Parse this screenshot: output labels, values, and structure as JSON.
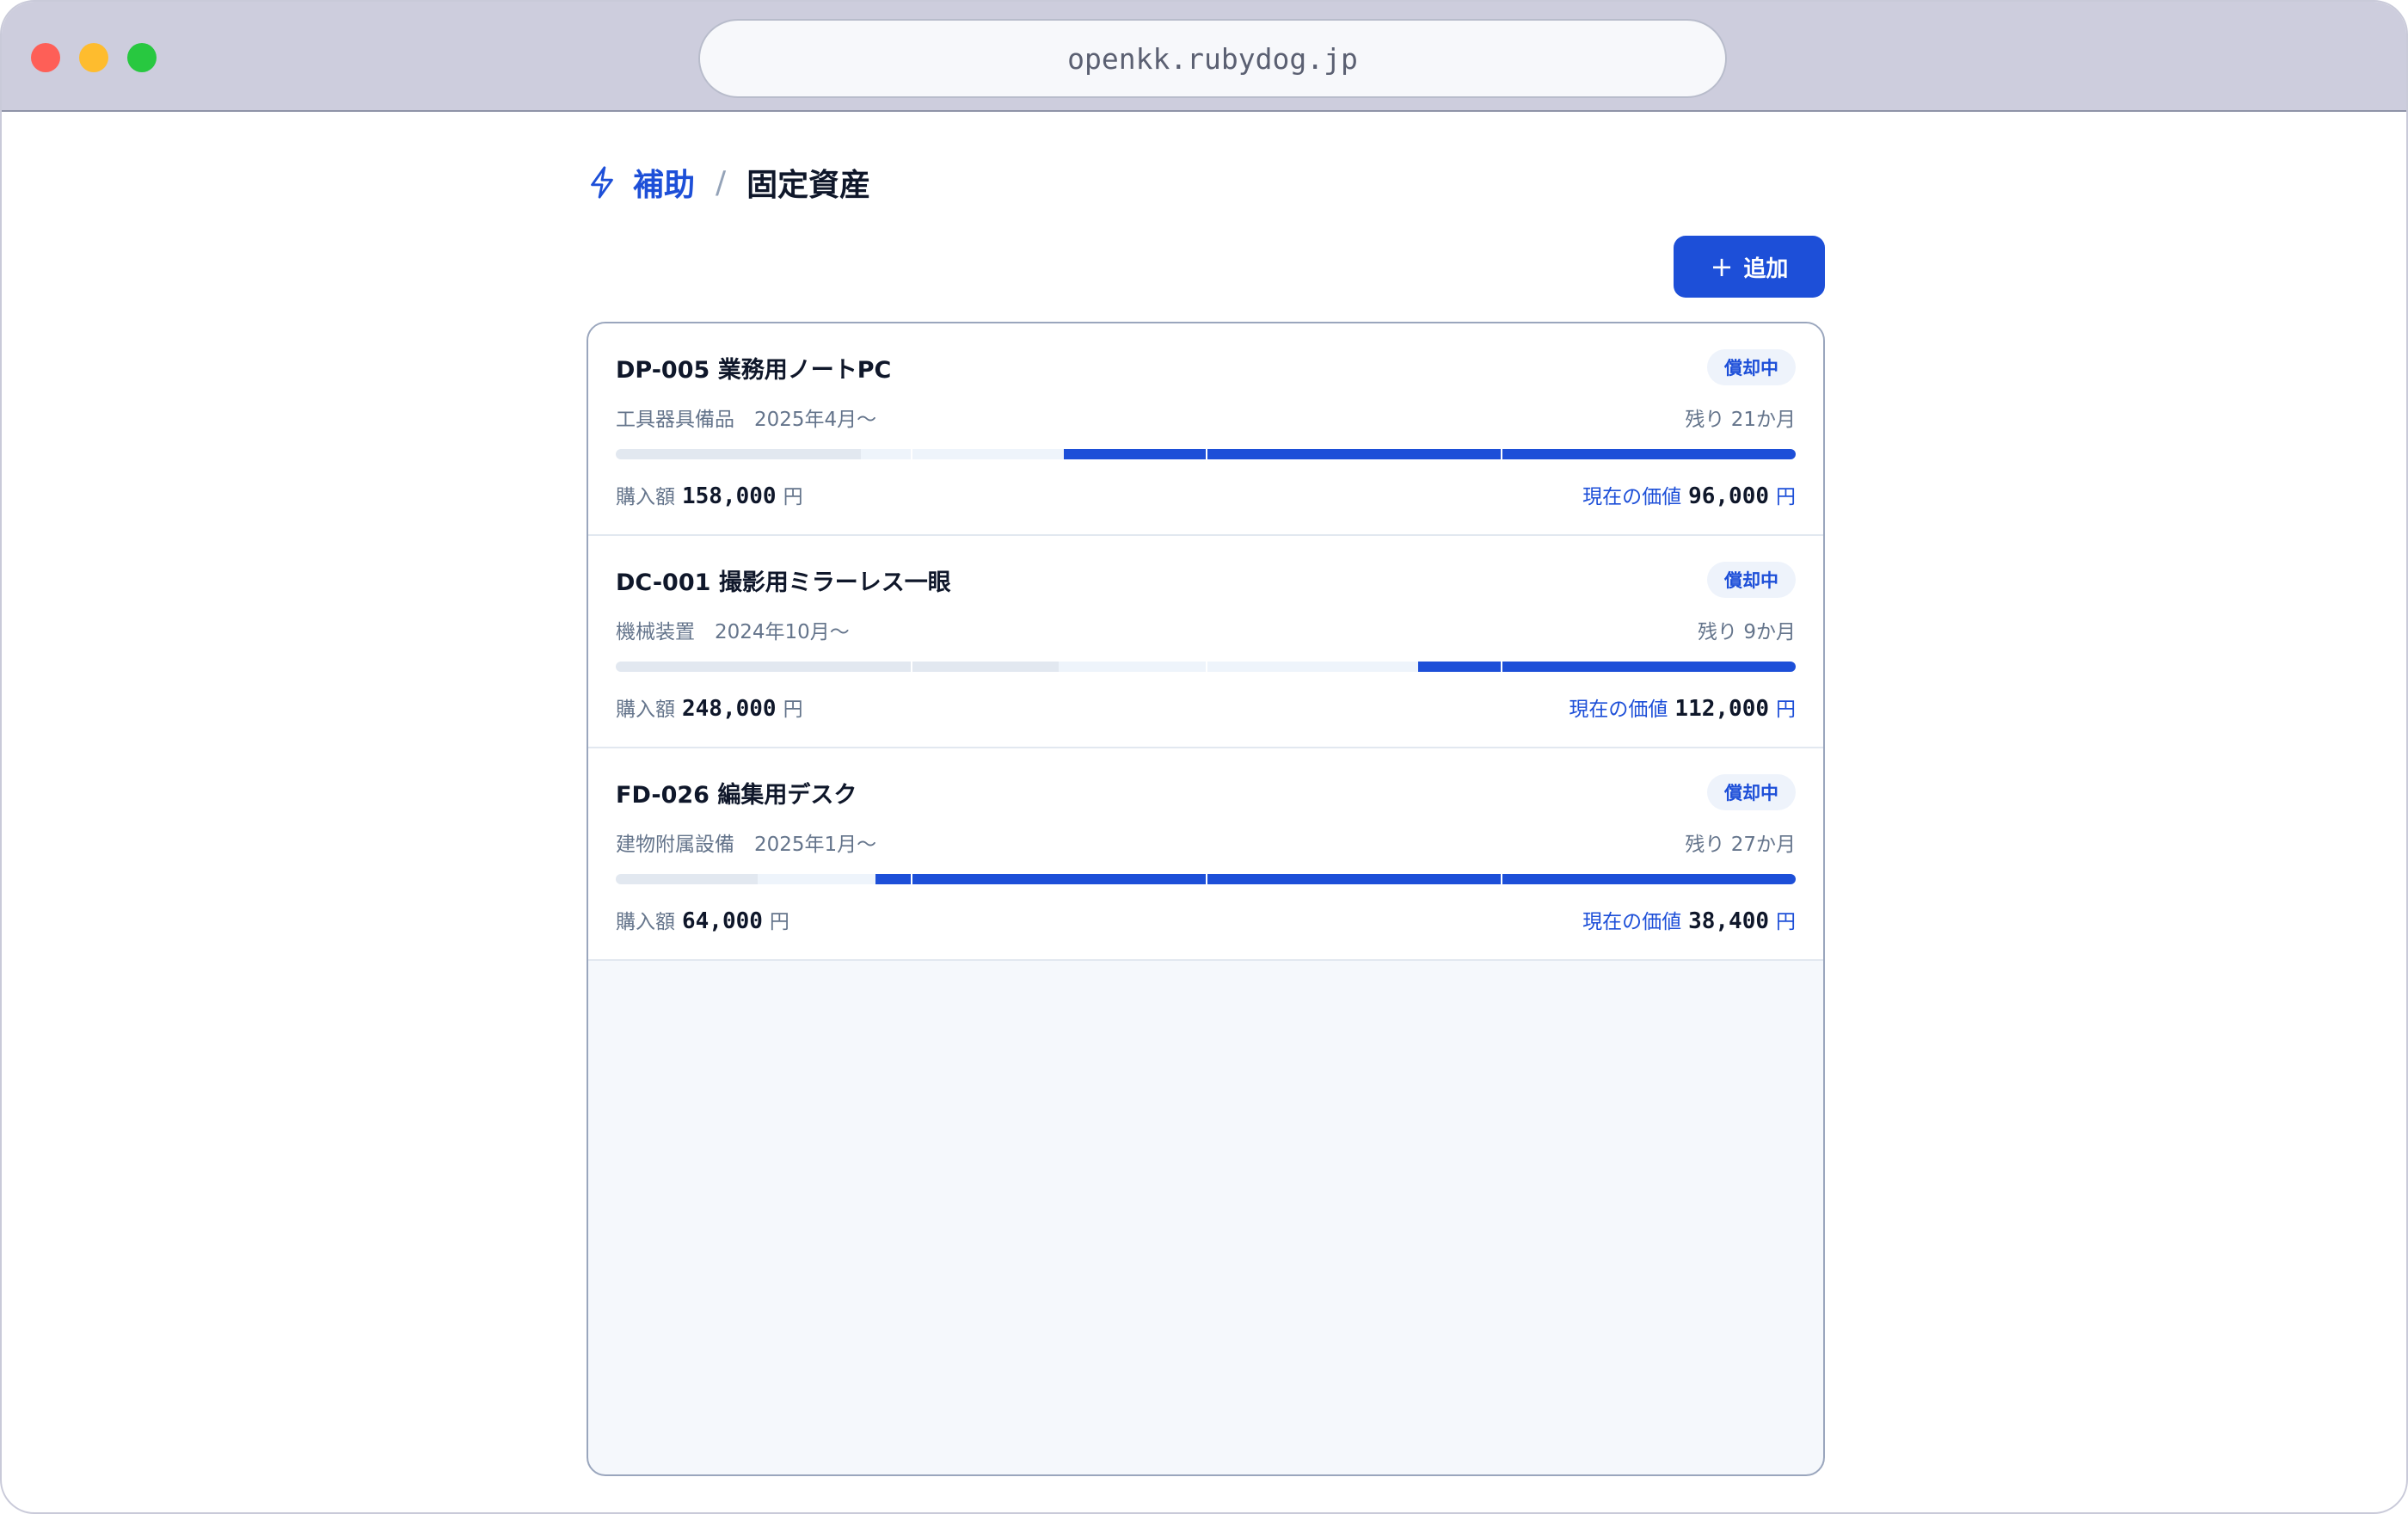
{
  "browser": {
    "url": "openkk.rubydog.jp"
  },
  "breadcrumb": {
    "parent": "補助",
    "separator": "/",
    "current": "固定資産"
  },
  "toolbar": {
    "add_label": "追加"
  },
  "assets": [
    {
      "title": "DP-005 業務用ノートPC",
      "status": "償却中",
      "category_start": "工具器具備品　2025年4月〜",
      "remaining": "残り 21か月",
      "purchase_label": "購入額",
      "purchase_amount": "158,000",
      "current_label": "現在の価値",
      "current_amount": "96,000",
      "unit": "円",
      "bar": [
        {
          "from": 0.0,
          "to": 0.208,
          "kind": "gray"
        },
        {
          "from": 0.208,
          "to": 0.25,
          "kind": "light"
        },
        {
          "from": 0.25,
          "to": 0.38,
          "kind": "light"
        },
        {
          "from": 0.38,
          "to": 0.5,
          "kind": "blue"
        },
        {
          "from": 0.5,
          "to": 0.75,
          "kind": "blue"
        },
        {
          "from": 0.75,
          "to": 1.0,
          "kind": "blue"
        }
      ]
    },
    {
      "title": "DC-001 撮影用ミラーレス一眼",
      "status": "償却中",
      "category_start": "機械装置　2024年10月〜",
      "remaining": "残り 9か月",
      "purchase_label": "購入額",
      "purchase_amount": "248,000",
      "current_label": "現在の価値",
      "current_amount": "112,000",
      "unit": "円",
      "bar": [
        {
          "from": 0.0,
          "to": 0.25,
          "kind": "gray"
        },
        {
          "from": 0.25,
          "to": 0.375,
          "kind": "gray"
        },
        {
          "from": 0.375,
          "to": 0.5,
          "kind": "light"
        },
        {
          "from": 0.5,
          "to": 0.68,
          "kind": "light"
        },
        {
          "from": 0.68,
          "to": 0.75,
          "kind": "blue"
        },
        {
          "from": 0.75,
          "to": 1.0,
          "kind": "blue"
        }
      ]
    },
    {
      "title": "FD-026 編集用デスク",
      "status": "償却中",
      "category_start": "建物附属設備　2025年1月〜",
      "remaining": "残り 27か月",
      "purchase_label": "購入額",
      "purchase_amount": "64,000",
      "current_label": "現在の価値",
      "current_amount": "38,400",
      "unit": "円",
      "bar": [
        {
          "from": 0.0,
          "to": 0.12,
          "kind": "gray"
        },
        {
          "from": 0.12,
          "to": 0.22,
          "kind": "light"
        },
        {
          "from": 0.22,
          "to": 0.25,
          "kind": "blue"
        },
        {
          "from": 0.25,
          "to": 0.5,
          "kind": "blue"
        },
        {
          "from": 0.5,
          "to": 0.75,
          "kind": "blue"
        },
        {
          "from": 0.75,
          "to": 1.0,
          "kind": "blue"
        }
      ]
    }
  ],
  "colors": {
    "accent": "#1d4fd8",
    "muted": "#64748b",
    "track": "#e2e8f0"
  },
  "icons": {
    "breadcrumb": "bolt-icon",
    "add": "plus-icon"
  }
}
